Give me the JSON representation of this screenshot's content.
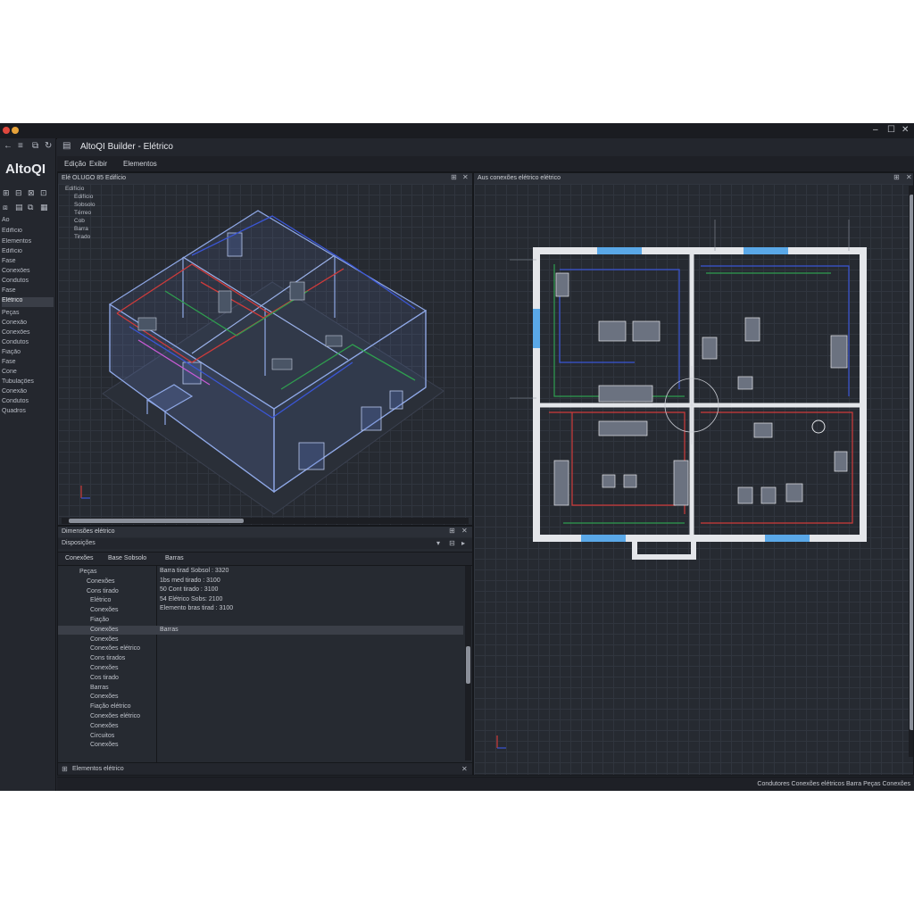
{
  "app": {
    "brand": "AltoQI",
    "document_title": "AltoQI Builder - Elétrico",
    "menu": [
      "Edição",
      "Exibir",
      "Elementos"
    ]
  },
  "left_sidebar": {
    "search_label": "Ao",
    "header_item": "Edifício",
    "items_group1": [
      "Elementos",
      "Edifício",
      "Fase",
      "Conexões",
      "Condutos",
      "Fase",
      "Elétrico"
    ],
    "items_group2": [
      "Peças",
      "Conexão",
      "Conexões",
      "Condutos",
      "Fiação",
      "Fase",
      "Cone",
      "Tubulações",
      "Conexão",
      "Condutos",
      "Quadros"
    ]
  },
  "view3d_panel": {
    "header": "Elé  OLUGO 85 Edifício",
    "tree": [
      "Edifício",
      "Edifício",
      "Sobsolo",
      "Térreo",
      "Cob",
      "Barra",
      "Tirado"
    ]
  },
  "properties_panel": {
    "header": "Dimensões elétrico",
    "subheader": "Disposições",
    "columns": [
      "Conexões",
      "Base Sobsolo",
      "Barras"
    ],
    "tree": [
      "Peças",
      "Conexões",
      "Cons tirado",
      "Elétrico",
      "Conexões",
      "Fiação",
      "Conexões",
      "Conexões",
      "Conexões elétrico",
      "Cons tirados",
      "Conexões",
      "Cos tirado",
      "Barras",
      "Conexões",
      "Fiação elétrico",
      "Conexões elétrico",
      "Conexões",
      "Circuitos",
      "Conexões"
    ],
    "selected_index": 6,
    "props": [
      "Barra tirad Sobsol : 3320",
      "1bs      med tirado : 3100",
      "50       Cont tirado : 3100",
      "54       Elétrico Sobs: 2100",
      "Elemento bras tirad : 3100"
    ],
    "selected_value": "Barras",
    "footer": "Elementos elétrico"
  },
  "plan_panel": {
    "header": "Aus conexões elétrico elétrico"
  },
  "status": {
    "text": "Condutores  Conexões elétricos  Barra  Peças  Conexões"
  },
  "colors": {
    "window_bg": "#23262d",
    "panel_bg": "#262a31",
    "wire_blue": "#3a56d6",
    "wire_red": "#cf3b3b",
    "wire_green": "#2f9e4f",
    "window_accent": "#5aa8e8",
    "wall": "#e4e6ea"
  }
}
